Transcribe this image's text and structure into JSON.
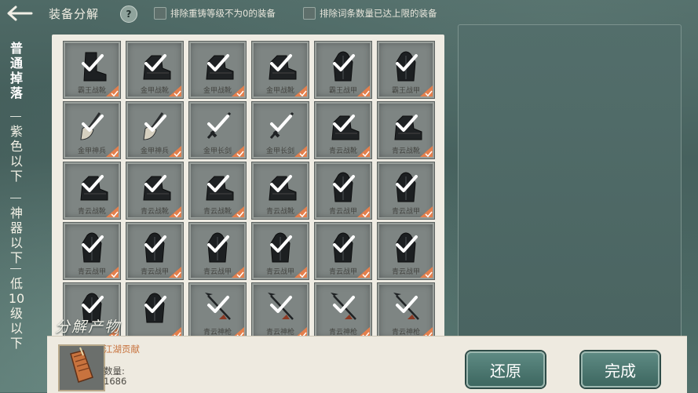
{
  "header": {
    "title": "装备分解",
    "help": "?",
    "option1": "排除重铸等级不为0的装备",
    "option2": "排除词条数量已达上限的装备"
  },
  "filters": [
    {
      "label": "普通掉落",
      "active": true
    },
    {
      "label": "紫色以下",
      "active": false
    },
    {
      "label": "神器以下",
      "active": false
    },
    {
      "label": "低10级以下",
      "active": false
    }
  ],
  "equipment": [
    {
      "name": "霸王战靴",
      "icon": "boot-icon"
    },
    {
      "name": "金甲战靴",
      "icon": "shoe-icon"
    },
    {
      "name": "金甲战靴",
      "icon": "shoe-icon"
    },
    {
      "name": "金甲战靴",
      "icon": "shoe-icon"
    },
    {
      "name": "霸王战甲",
      "icon": "armor-icon"
    },
    {
      "name": "霸王战甲",
      "icon": "armor-icon"
    },
    {
      "name": "金甲神兵",
      "icon": "shovel-icon"
    },
    {
      "name": "金甲神兵",
      "icon": "shovel-icon"
    },
    {
      "name": "金甲长剑",
      "icon": "sword-icon"
    },
    {
      "name": "金甲长剑",
      "icon": "sword-icon"
    },
    {
      "name": "青云战靴",
      "icon": "shoe-icon"
    },
    {
      "name": "青云战靴",
      "icon": "shoe-icon"
    },
    {
      "name": "青云战靴",
      "icon": "shoe-icon"
    },
    {
      "name": "青云战靴",
      "icon": "shoe-icon"
    },
    {
      "name": "青云战靴",
      "icon": "shoe-icon"
    },
    {
      "name": "青云战靴",
      "icon": "shoe-icon"
    },
    {
      "name": "青云战甲",
      "icon": "armor-icon"
    },
    {
      "name": "青云战甲",
      "icon": "armor-icon"
    },
    {
      "name": "青云战甲",
      "icon": "armor-icon"
    },
    {
      "name": "青云战甲",
      "icon": "armor-icon"
    },
    {
      "name": "青云战甲",
      "icon": "armor-icon"
    },
    {
      "name": "青云战甲",
      "icon": "armor-icon"
    },
    {
      "name": "青云战甲",
      "icon": "armor-icon"
    },
    {
      "name": "青云战甲",
      "icon": "armor-icon"
    },
    {
      "name": "",
      "icon": "armor-icon"
    },
    {
      "name": "",
      "icon": "armor-icon"
    },
    {
      "name": "青云神枪",
      "icon": "spear-icon"
    },
    {
      "name": "青云神枪",
      "icon": "spear-icon"
    },
    {
      "name": "青云神枪",
      "icon": "spear-icon"
    },
    {
      "name": "青云神枪",
      "icon": "spear-icon"
    }
  ],
  "output": {
    "label": "分解产物",
    "item_name": "江湖贡献",
    "qty_label": "数量:",
    "qty": "1686"
  },
  "buttons": {
    "restore": "还原",
    "done": "完成"
  },
  "colors": {
    "accent": "#e47f4c",
    "button": "#4e7a73",
    "panel": "#efece3"
  }
}
